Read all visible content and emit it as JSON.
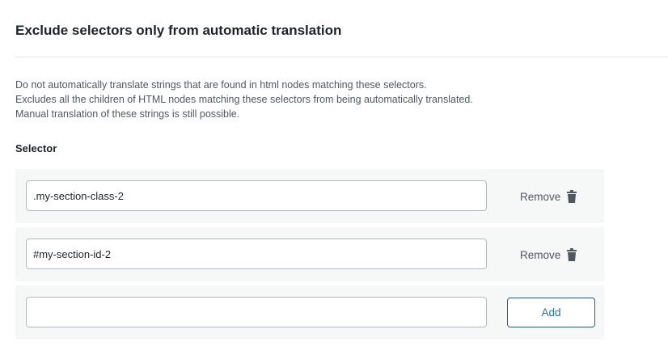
{
  "section": {
    "title": "Exclude selectors only from automatic translation",
    "description": [
      "Do not automatically translate strings that are found in html nodes matching these selectors.",
      "Excludes all the children of HTML nodes matching these selectors from being automatically translated.",
      "Manual translation of these strings is still possible."
    ],
    "selector_label": "Selector"
  },
  "rows": [
    {
      "value": ".my-section-class-2",
      "remove_label": "Remove",
      "icon": "trash-icon"
    },
    {
      "value": "#my-section-id-2",
      "remove_label": "Remove",
      "icon": "trash-icon"
    }
  ],
  "new_row": {
    "value": "",
    "add_label": "Add"
  },
  "colors": {
    "accent": "#2271b1",
    "row_background": "#f6f7f7",
    "text_muted": "#50575e"
  }
}
